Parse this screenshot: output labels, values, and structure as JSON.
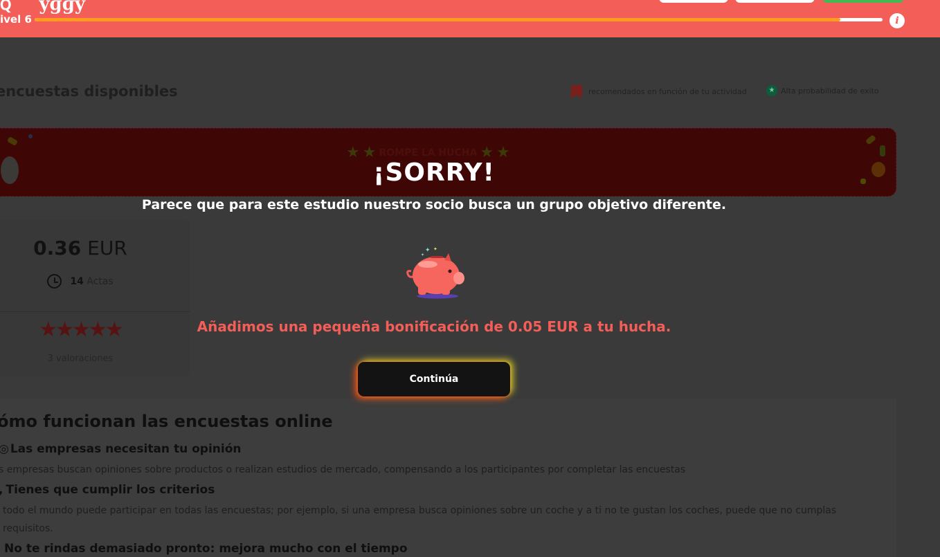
{
  "header": {
    "level_label": "ivel 6",
    "level_progress": 0.95,
    "info_icon": "i"
  },
  "page": {
    "title": "encuestas disponibles",
    "legend_recommended": "recomendados en función de tu actividad",
    "legend_high_prob": "Alta probabilidad de exito"
  },
  "banner": {
    "title": "ROMPE LA HUCHA",
    "star": "★"
  },
  "survey_card": {
    "price_value": "0.36",
    "price_currency": "EUR",
    "time_value": "14",
    "time_unit": "Actas",
    "stars": "★★★★★",
    "ratings": "3 valoraciones"
  },
  "howto": {
    "title": "ómo funcionan las encuestas online",
    "step1_title": "Las empresas necesitan tu opinión",
    "step1_text": "s empresas buscan opiniones sobre productos o realizan estudios de mercado, compensando a los participantes por completar las encuestas",
    "step2_title": "Tienes que cumplir los criterios",
    "step2_text": "todo el mundo puede participar en todas las encuestas; por ejemplo, si una empresa busca opiniones sobre un coche y a ti no te gustan los coches, puede que no cumplas",
    "step2_text_cont": "requisitos.",
    "step3_title": "No te rindas demasiado pronto: mejora mucho con el tiempo"
  },
  "modal": {
    "title": "¡SORRY!",
    "message": "Parece que para este estudio nuestro socio busca un grupo objetivo diferente.",
    "bonus": "Añadimos una pequeña bonificación de 0.05 EUR a tu hucha.",
    "continue_label": "Continúa"
  },
  "colors": {
    "header": "#f35e58",
    "accent_orange": "#ff9b1e",
    "bonus_text": "#f35e58",
    "button_bg": "#131313"
  }
}
